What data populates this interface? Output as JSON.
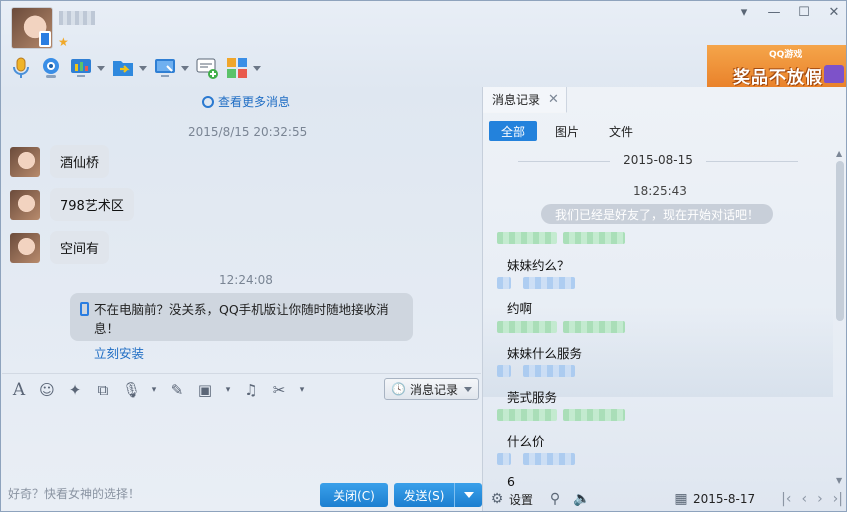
{
  "header": {
    "contact_name_blurred": "",
    "window_controls": [
      "chevron-down",
      "minimize",
      "maximize",
      "close"
    ],
    "ad": {
      "logo": "QQ游戏",
      "text": "奖品不放假"
    }
  },
  "toolbar": {
    "items": [
      "microphone-icon",
      "video-icon",
      "screen-share-icon",
      "file-transfer-icon",
      "remote-desktop-icon",
      "send-sms-icon",
      "apps-icon"
    ]
  },
  "chat": {
    "more_link": "查看更多消息",
    "timestamp_1": "2015/8/15 20:32:55",
    "messages": [
      "酒仙桥",
      "798艺术区",
      "空间有"
    ],
    "timestamp_2": "12:24:08",
    "notice_text": "不在电脑前？没关系，QQ手机版让你随时随地接收消息！",
    "notice_link": "立刻安装"
  },
  "input_toolbar": {
    "history_label": "消息记录"
  },
  "input": {
    "hint": "好奇？快看女神的选择！",
    "close_label": "关闭(C)",
    "send_label": "发送(S)"
  },
  "right_panel": {
    "tab_label": "消息记录",
    "filters": [
      "全部",
      "图片",
      "文件"
    ],
    "date": "2015-08-15",
    "time": "18:25:43",
    "system_notice": "我们已经是好友了，现在开始对话吧！",
    "messages": [
      "妹妹约么？",
      "约啊",
      "妹妹什么服务",
      "莞式服务",
      "什么价",
      "6"
    ],
    "footer": {
      "settings_label": "设置",
      "date": "2015-8-17"
    }
  },
  "colors": {
    "accent": "#2382dc",
    "link": "#1f6dc4",
    "bubble": "#e0e5ec"
  }
}
